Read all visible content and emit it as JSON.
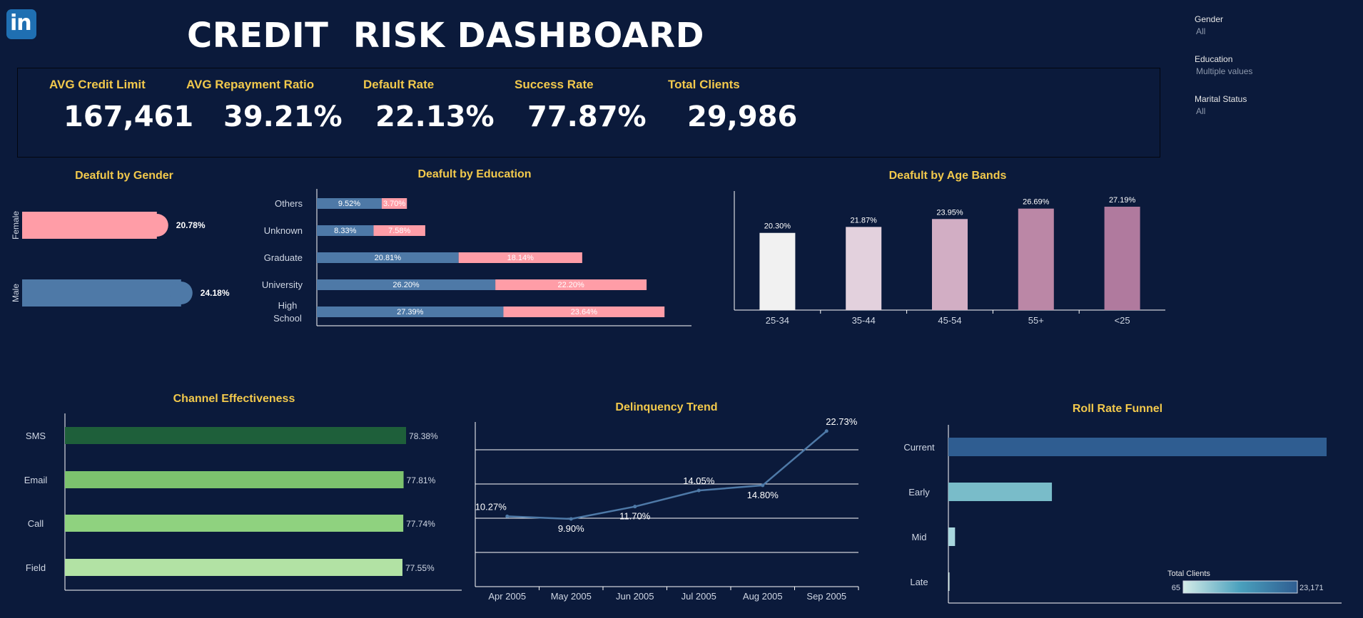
{
  "header": {
    "title": "CREDIT  RISK DASHBOARD",
    "logo_icon": "linkedin-icon"
  },
  "kpis": [
    {
      "label": "AVG Credit Limit",
      "value": "167,461"
    },
    {
      "label": "AVG Repayment Ratio",
      "value": "39.21%"
    },
    {
      "label": "Default Rate",
      "value": "22.13%"
    },
    {
      "label": "Success Rate",
      "value": "77.87%"
    },
    {
      "label": "Total Clients",
      "value": "29,986"
    }
  ],
  "filters": [
    {
      "label": "Gender",
      "value": "All"
    },
    {
      "label": "Education",
      "value": "Multiple values"
    },
    {
      "label": "Marital Status",
      "value": "All"
    }
  ],
  "colors": {
    "background": "#0b1a3b",
    "accent": "#f2c94c",
    "blue": "#4e79a7",
    "pink": "#ff9da7"
  },
  "chart_data": [
    {
      "id": "gender",
      "type": "bar",
      "orientation": "horizontal",
      "title": "Deafult by Gender",
      "categories": [
        "Female",
        "Male"
      ],
      "values": [
        20.78,
        24.18
      ],
      "labels": [
        "20.78%",
        "24.18%"
      ],
      "colors": [
        "#ff9da7",
        "#4e79a7"
      ],
      "xlim": [
        0,
        30
      ]
    },
    {
      "id": "education",
      "type": "bar",
      "orientation": "horizontal",
      "stacked": true,
      "title": "Deafult by Education",
      "categories": [
        "Others",
        "Unknown",
        "Graduate",
        "University",
        "High School"
      ],
      "series": [
        {
          "values": [
            9.52,
            8.33,
            20.81,
            26.2,
            27.39
          ],
          "labels": [
            "9.52%",
            "8.33%",
            "20.81%",
            "26.20%",
            "27.39%"
          ],
          "color": "#4e79a7"
        },
        {
          "values": [
            3.7,
            7.58,
            18.14,
            22.2,
            23.64
          ],
          "labels": [
            "3.70%",
            "7.58%",
            "18.14%",
            "22.20%",
            "23.64%"
          ],
          "color": "#ff9da7"
        }
      ],
      "xlim": [
        0,
        53
      ]
    },
    {
      "id": "age",
      "type": "bar",
      "title": "Deafult by Age Bands",
      "categories": [
        "25-34",
        "35-44",
        "45-54",
        "55+",
        "<25"
      ],
      "values": [
        20.3,
        21.87,
        23.95,
        26.69,
        27.19
      ],
      "labels": [
        "20.30%",
        "21.87%",
        "23.95%",
        "26.69%",
        "27.19%"
      ],
      "colors": [
        "#f1f1f1",
        "#e3d1dd",
        "#d2aec4",
        "#bb87a6",
        "#b07a9e"
      ],
      "ylim": [
        0,
        30
      ]
    },
    {
      "id": "channel",
      "type": "bar",
      "orientation": "horizontal",
      "title": "Channel Effectiveness",
      "categories": [
        "SMS",
        "Email",
        "Call",
        "Field"
      ],
      "values": [
        78.38,
        77.81,
        77.74,
        77.55
      ],
      "labels": [
        "78.38%",
        "77.81%",
        "77.74%",
        "77.55%"
      ],
      "colors": [
        "#1e5f3a",
        "#7cc26e",
        "#8fd27f",
        "#b2e2a4"
      ],
      "xlim": [
        0,
        91
      ]
    },
    {
      "id": "delinquency",
      "type": "line",
      "title": "Delinquency Trend",
      "x": [
        "Apr 2005",
        "May 2005",
        "Jun 2005",
        "Jul 2005",
        "Aug 2005",
        "Sep 2005"
      ],
      "values": [
        10.27,
        9.9,
        11.7,
        14.05,
        14.8,
        22.73
      ],
      "labels": [
        "10.27%",
        "9.90%",
        "11.70%",
        "14.05%",
        "14.80%",
        "22.73%"
      ],
      "grid": true,
      "ylim": [
        0,
        25
      ]
    },
    {
      "id": "rollrate",
      "type": "bar",
      "orientation": "horizontal",
      "title": "Roll Rate Funnel",
      "categories": [
        "Current",
        "Early",
        "Mid",
        "Late"
      ],
      "values": [
        23171,
        6342,
        408,
        65
      ],
      "colors": [
        "#2f5d91",
        "#79bcc9",
        "#a8d7de",
        "#d4ece8"
      ],
      "legend": {
        "title": "Total Clients",
        "min": "65",
        "max": "23,171",
        "position": "bottom-right"
      }
    }
  ]
}
